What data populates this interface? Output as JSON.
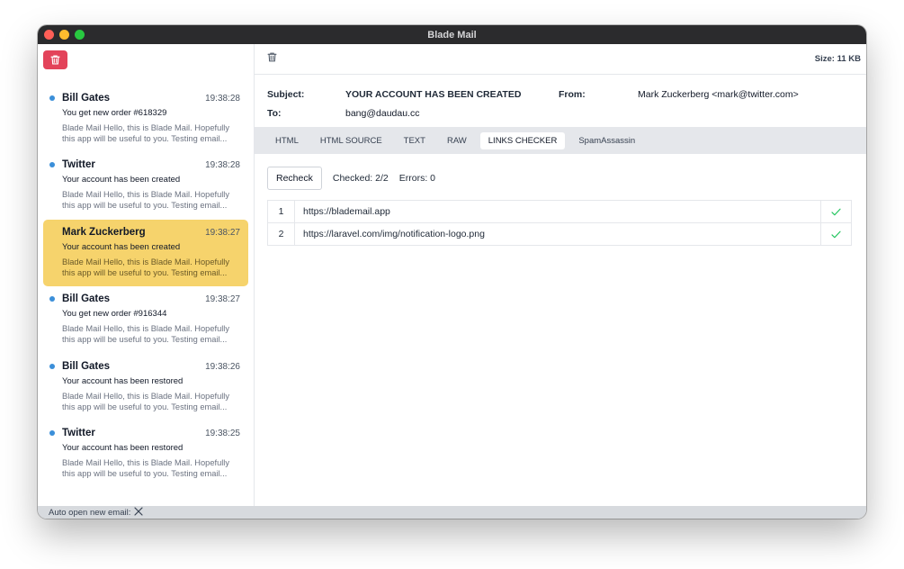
{
  "window": {
    "title": "Blade Mail"
  },
  "mails": [
    {
      "sender": "Bill Gates",
      "time": "19:38:28",
      "subject": "You get new order #618329",
      "preview": "Blade Mail Hello, this is Blade Mail. Hopefully this app will be useful to you. Testing email..."
    },
    {
      "sender": "Twitter",
      "time": "19:38:28",
      "subject": "Your account has been created",
      "preview": "Blade Mail Hello, this is Blade Mail. Hopefully this app will be useful to you. Testing email..."
    },
    {
      "sender": "Mark Zuckerberg",
      "time": "19:38:27",
      "subject": "Your account has been created",
      "preview": "Blade Mail Hello, this is Blade Mail. Hopefully this app will be useful to you. Testing email..."
    },
    {
      "sender": "Bill Gates",
      "time": "19:38:27",
      "subject": "You get new order #916344",
      "preview": "Blade Mail Hello, this is Blade Mail. Hopefully this app will be useful to you. Testing email..."
    },
    {
      "sender": "Bill Gates",
      "time": "19:38:26",
      "subject": "Your account has been restored",
      "preview": "Blade Mail Hello, this is Blade Mail. Hopefully this app will be useful to you. Testing email..."
    },
    {
      "sender": "Twitter",
      "time": "19:38:25",
      "subject": "Your account has been restored",
      "preview": "Blade Mail Hello, this is Blade Mail. Hopefully this app will be useful to you. Testing email..."
    }
  ],
  "message": {
    "size": "Size: 11 KB",
    "subject_label": "Subject:",
    "subject": "YOUR ACCOUNT HAS BEEN CREATED",
    "from_label": "From:",
    "from": "Mark Zuckerberg <mark@twitter.com>",
    "to_label": "To:",
    "to": "bang@daudau.cc"
  },
  "tabs": [
    "HTML",
    "HTML SOURCE",
    "TEXT",
    "RAW",
    "LINKS CHECKER",
    "SpamAssassin"
  ],
  "links": {
    "recheck_label": "Recheck",
    "checked": "Checked: 2/2",
    "errors": "Errors: 0",
    "rows": [
      {
        "num": "1",
        "url": "https://blademail.app"
      },
      {
        "num": "2",
        "url": "https://laravel.com/img/notification-logo.png"
      }
    ]
  },
  "status": {
    "auto_open": "Auto open new email:"
  },
  "colors": {
    "accent": "#f6d36c",
    "danger": "#e3435a",
    "unread": "#3b8fd9",
    "ok": "#22c55e"
  }
}
